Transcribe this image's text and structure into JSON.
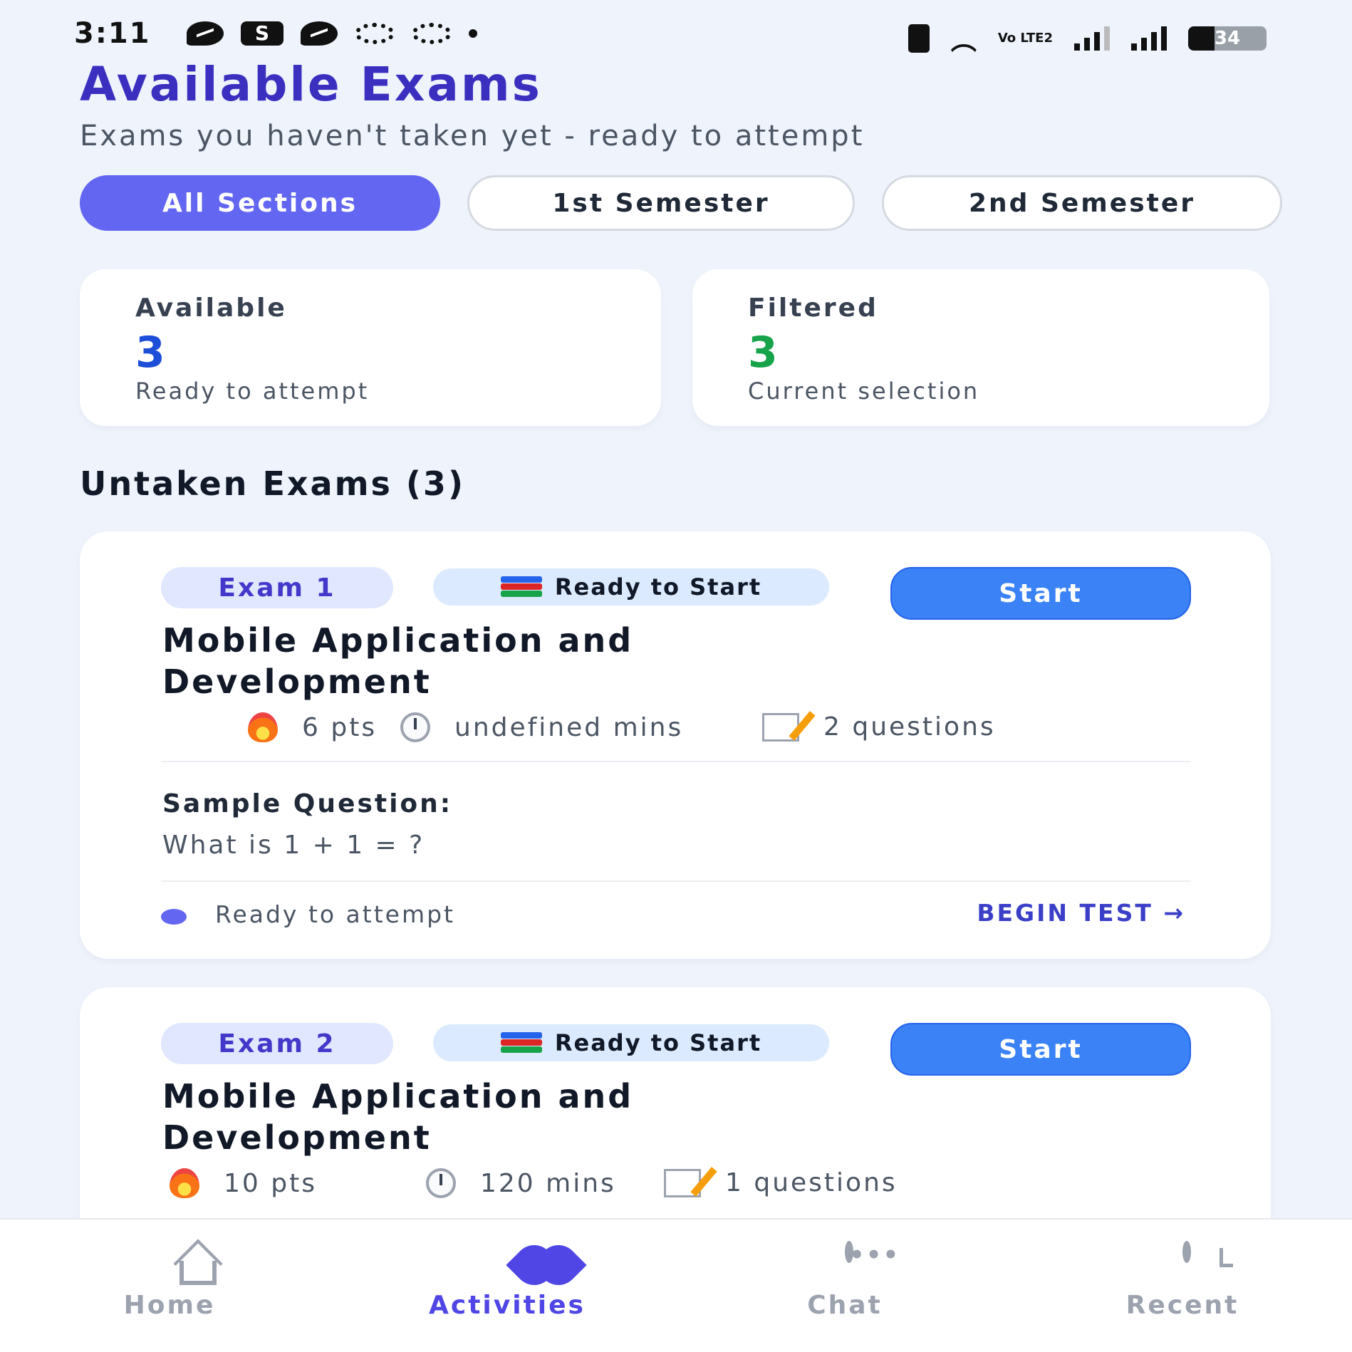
{
  "status_bar": {
    "time": "3:11",
    "volte": "Vo LTE2",
    "battery_level": "34",
    "battery_fill_percent": 34
  },
  "header": {
    "title": "Available Exams",
    "subtitle": "Exams you haven't taken yet - ready to attempt"
  },
  "tabs": [
    {
      "label": "All Sections",
      "active": true
    },
    {
      "label": "1st Semester",
      "active": false
    },
    {
      "label": "2nd Semester",
      "active": false
    }
  ],
  "stats": {
    "available": {
      "label": "Available",
      "value": "3",
      "caption": "Ready to attempt",
      "color": "#1d4ed8"
    },
    "filtered": {
      "label": "Filtered",
      "value": "3",
      "caption": "Current selection",
      "color": "#16a34a"
    }
  },
  "section_heading": "Untaken Exams (3)",
  "exams": [
    {
      "badge": "Exam 1",
      "status": "Ready to Start",
      "start_label": "Start",
      "title": "Mobile Application and Development",
      "points": "6 pts",
      "duration": "undefined mins",
      "questions": "2 questions",
      "sample_label": "Sample Question:",
      "sample_text": "What is 1 + 1 = ?",
      "ready_text": "Ready to attempt",
      "begin_label": "BEGIN TEST →"
    },
    {
      "badge": "Exam 2",
      "status": "Ready to Start",
      "start_label": "Start",
      "title": "Mobile Application and Development",
      "points": "10 pts",
      "duration": "120 mins",
      "questions": "1 questions"
    }
  ],
  "bottom_nav": [
    {
      "label": "Home",
      "icon": "home-icon",
      "active": false
    },
    {
      "label": "Activities",
      "icon": "heart-pulse-icon",
      "active": true
    },
    {
      "label": "Chat",
      "icon": "chat-bubble-icon",
      "active": false
    },
    {
      "label": "Recent",
      "icon": "clock-icon",
      "active": false
    }
  ],
  "colors": {
    "accent": "#6366f1",
    "title": "#3b2fc0",
    "start_button": "#3b82f6",
    "nav_active": "#4f46e5",
    "nav_inactive": "#9ca3af"
  }
}
